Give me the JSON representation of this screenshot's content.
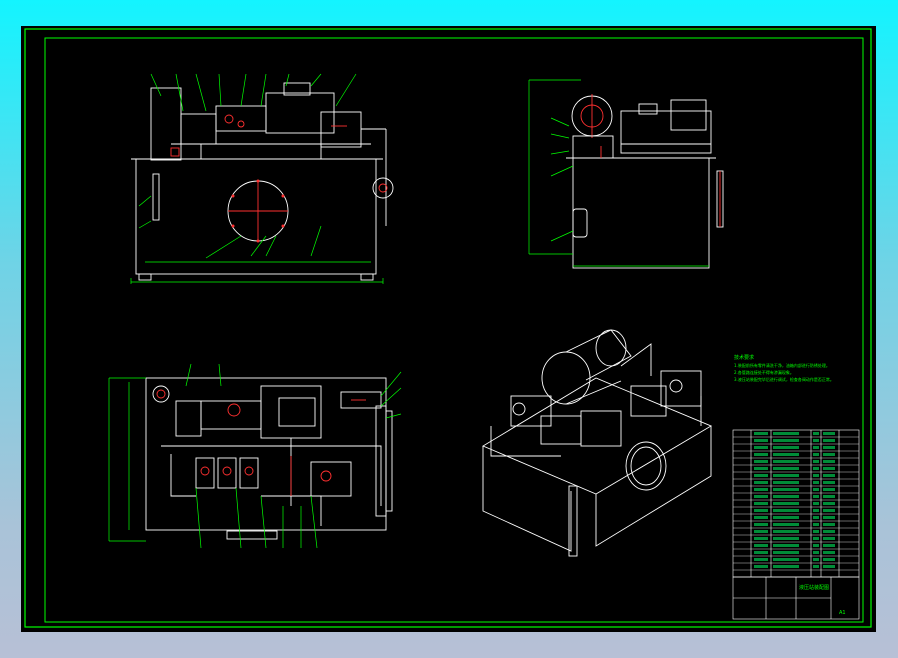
{
  "colors": {
    "background_gradient_top": "#13f4ff",
    "background_gradient_bottom": "#b7c0d6",
    "drawing_background": "#000000",
    "frame_line": "#00ff00",
    "part_line": "#ffffff",
    "highlight_line": "#ff3030",
    "hatch": "#00ff66"
  },
  "views": [
    {
      "id": "front-view",
      "name": "front elevation"
    },
    {
      "id": "side-view",
      "name": "side elevation"
    },
    {
      "id": "top-view",
      "name": "plan view"
    },
    {
      "id": "iso-view",
      "name": "isometric view"
    }
  ],
  "notes": {
    "heading": "技术要求",
    "lines": [
      "1.装配前所有零件清洗干净，油箱内部进行防锈处理。",
      "2.各管路连接处不得有渗漏现象。",
      "3.液压站装配完毕后进行调试，检查各阀动作是否正常。"
    ]
  },
  "title_block": {
    "drawing_title": "液压站装配图",
    "sheet_size": "A1"
  }
}
